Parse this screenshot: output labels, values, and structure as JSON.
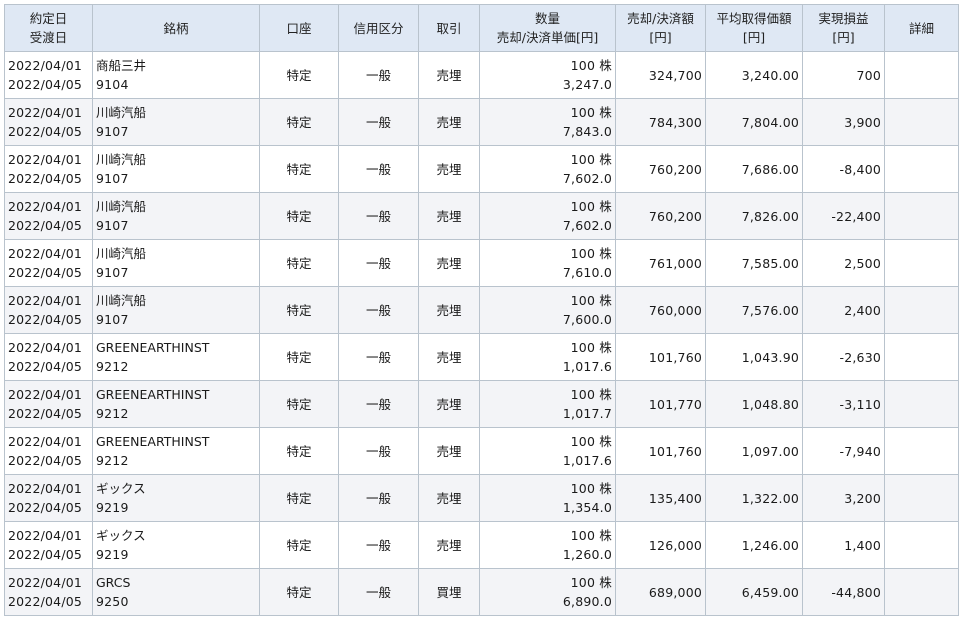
{
  "columns": {
    "date": [
      "約定日",
      "受渡日"
    ],
    "name": "銘柄",
    "account": "口座",
    "credit_type": "信用区分",
    "trade": "取引",
    "qty": [
      "数量",
      "売却/決済単価[円]"
    ],
    "amount": [
      "売却/決済額",
      "[円]"
    ],
    "avg_cost": [
      "平均取得価額",
      "[円]"
    ],
    "pnl": [
      "実現損益",
      "[円]"
    ],
    "detail": "詳細"
  },
  "rows": [
    {
      "trade_date": "2022/04/01",
      "settle_date": "2022/04/05",
      "name": "商船三井",
      "code": "9104",
      "account": "特定",
      "credit_type": "一般",
      "trade": "売埋",
      "qty": "100 株",
      "price": "3,247.0",
      "amount": "324,700",
      "avg_cost": "3,240.00",
      "pnl": "700"
    },
    {
      "trade_date": "2022/04/01",
      "settle_date": "2022/04/05",
      "name": "川崎汽船",
      "code": "9107",
      "account": "特定",
      "credit_type": "一般",
      "trade": "売埋",
      "qty": "100 株",
      "price": "7,843.0",
      "amount": "784,300",
      "avg_cost": "7,804.00",
      "pnl": "3,900"
    },
    {
      "trade_date": "2022/04/01",
      "settle_date": "2022/04/05",
      "name": "川崎汽船",
      "code": "9107",
      "account": "特定",
      "credit_type": "一般",
      "trade": "売埋",
      "qty": "100 株",
      "price": "7,602.0",
      "amount": "760,200",
      "avg_cost": "7,686.00",
      "pnl": "-8,400"
    },
    {
      "trade_date": "2022/04/01",
      "settle_date": "2022/04/05",
      "name": "川崎汽船",
      "code": "9107",
      "account": "特定",
      "credit_type": "一般",
      "trade": "売埋",
      "qty": "100 株",
      "price": "7,602.0",
      "amount": "760,200",
      "avg_cost": "7,826.00",
      "pnl": "-22,400"
    },
    {
      "trade_date": "2022/04/01",
      "settle_date": "2022/04/05",
      "name": "川崎汽船",
      "code": "9107",
      "account": "特定",
      "credit_type": "一般",
      "trade": "売埋",
      "qty": "100 株",
      "price": "7,610.0",
      "amount": "761,000",
      "avg_cost": "7,585.00",
      "pnl": "2,500"
    },
    {
      "trade_date": "2022/04/01",
      "settle_date": "2022/04/05",
      "name": "川崎汽船",
      "code": "9107",
      "account": "特定",
      "credit_type": "一般",
      "trade": "売埋",
      "qty": "100 株",
      "price": "7,600.0",
      "amount": "760,000",
      "avg_cost": "7,576.00",
      "pnl": "2,400"
    },
    {
      "trade_date": "2022/04/01",
      "settle_date": "2022/04/05",
      "name": "GREENEARTHINST",
      "code": "9212",
      "account": "特定",
      "credit_type": "一般",
      "trade": "売埋",
      "qty": "100 株",
      "price": "1,017.6",
      "amount": "101,760",
      "avg_cost": "1,043.90",
      "pnl": "-2,630"
    },
    {
      "trade_date": "2022/04/01",
      "settle_date": "2022/04/05",
      "name": "GREENEARTHINST",
      "code": "9212",
      "account": "特定",
      "credit_type": "一般",
      "trade": "売埋",
      "qty": "100 株",
      "price": "1,017.7",
      "amount": "101,770",
      "avg_cost": "1,048.80",
      "pnl": "-3,110"
    },
    {
      "trade_date": "2022/04/01",
      "settle_date": "2022/04/05",
      "name": "GREENEARTHINST",
      "code": "9212",
      "account": "特定",
      "credit_type": "一般",
      "trade": "売埋",
      "qty": "100 株",
      "price": "1,017.6",
      "amount": "101,760",
      "avg_cost": "1,097.00",
      "pnl": "-7,940"
    },
    {
      "trade_date": "2022/04/01",
      "settle_date": "2022/04/05",
      "name": "ギックス",
      "code": "9219",
      "account": "特定",
      "credit_type": "一般",
      "trade": "売埋",
      "qty": "100 株",
      "price": "1,354.0",
      "amount": "135,400",
      "avg_cost": "1,322.00",
      "pnl": "3,200"
    },
    {
      "trade_date": "2022/04/01",
      "settle_date": "2022/04/05",
      "name": "ギックス",
      "code": "9219",
      "account": "特定",
      "credit_type": "一般",
      "trade": "売埋",
      "qty": "100 株",
      "price": "1,260.0",
      "amount": "126,000",
      "avg_cost": "1,246.00",
      "pnl": "1,400"
    },
    {
      "trade_date": "2022/04/01",
      "settle_date": "2022/04/05",
      "name": "GRCS",
      "code": "9250",
      "account": "特定",
      "credit_type": "一般",
      "trade": "買埋",
      "qty": "100 株",
      "price": "6,890.0",
      "amount": "689,000",
      "avg_cost": "6,459.00",
      "pnl": "-44,800"
    }
  ]
}
